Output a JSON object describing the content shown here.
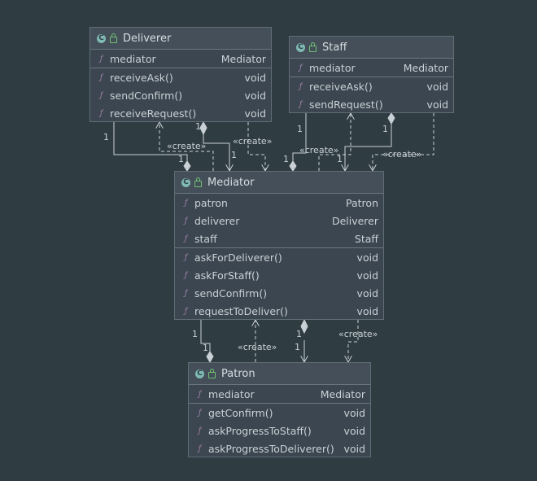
{
  "classes": {
    "deliverer": {
      "name": "Deliverer",
      "fields": [
        {
          "name": "mediator",
          "type": "Mediator"
        }
      ],
      "methods": [
        {
          "name": "receiveAsk()",
          "type": "void"
        },
        {
          "name": "sendConfirm()",
          "type": "void"
        },
        {
          "name": "receiveRequest()",
          "type": "void"
        }
      ]
    },
    "staff": {
      "name": "Staff",
      "fields": [
        {
          "name": "mediator",
          "type": "Mediator"
        }
      ],
      "methods": [
        {
          "name": "receiveAsk()",
          "type": "void"
        },
        {
          "name": "sendRequest()",
          "type": "void"
        }
      ]
    },
    "mediator": {
      "name": "Mediator",
      "fields": [
        {
          "name": "patron",
          "type": "Patron"
        },
        {
          "name": "deliverer",
          "type": "Deliverer"
        },
        {
          "name": "staff",
          "type": "Staff"
        }
      ],
      "methods": [
        {
          "name": "askForDeliverer()",
          "type": "void"
        },
        {
          "name": "askForStaff()",
          "type": "void"
        },
        {
          "name": "sendConfirm()",
          "type": "void"
        },
        {
          "name": "requestToDeliver()",
          "type": "void"
        }
      ]
    },
    "patron": {
      "name": "Patron",
      "fields": [
        {
          "name": "mediator",
          "type": "Mediator"
        }
      ],
      "methods": [
        {
          "name": "getConfirm()",
          "type": "void"
        },
        {
          "name": "askProgressToStaff()",
          "type": "void"
        },
        {
          "name": "askProgressToDeliverer()",
          "type": "void"
        }
      ]
    }
  },
  "labels": {
    "create": "«create»",
    "one": "1"
  },
  "colors": {
    "background": "#2f3c42",
    "line": "#c9d1d6",
    "class_icon": "#7fb9b3",
    "lock_icon": "#6fbf73"
  }
}
